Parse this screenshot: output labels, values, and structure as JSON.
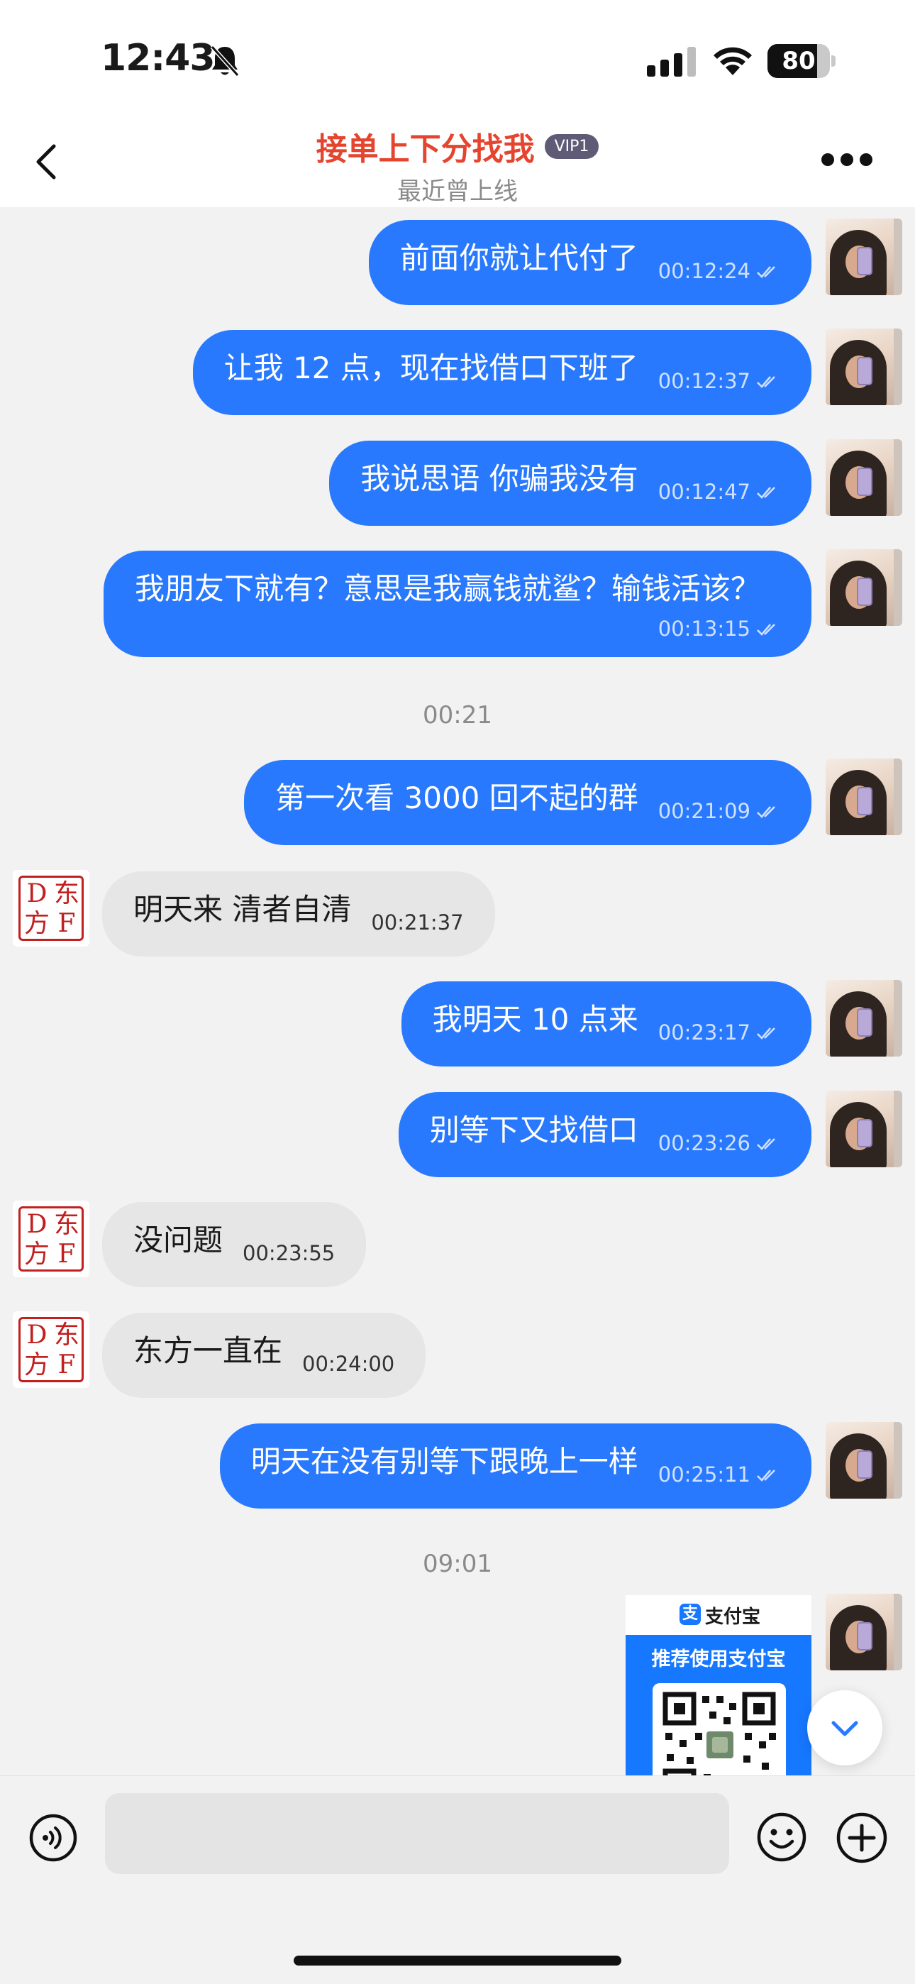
{
  "status_bar": {
    "time": "12:43",
    "battery": 80,
    "icons": [
      "bell-slash-icon",
      "signal-icon",
      "wifi-icon",
      "battery-icon"
    ]
  },
  "header": {
    "title": "接单上下分找我",
    "badge": "VIP1",
    "subtitle": "最近曾上线",
    "back_icon": "chevron-left-icon",
    "more_icon": "more-dots-icon"
  },
  "messages": [
    {
      "dir": "out",
      "text": "前面你就让代付了",
      "time": "00:12:24"
    },
    {
      "dir": "out",
      "text": "让我 12 点，现在找借口下班了",
      "time": "00:12:37"
    },
    {
      "dir": "out",
      "text": "我说思语 你骗我没有",
      "time": "00:12:47"
    },
    {
      "dir": "out",
      "text": "我朋友下就有？意思是我赢钱就鲨？输钱活该？",
      "time": "00:13:15"
    },
    {
      "dir": "divider",
      "text": "00:21"
    },
    {
      "dir": "out",
      "text": "第一次看 3000 回不起的群",
      "time": "00:21:09"
    },
    {
      "dir": "in",
      "text": "明天来  清者自清",
      "time": "00:21:37"
    },
    {
      "dir": "out",
      "text": "我明天 10 点来",
      "time": "00:23:17"
    },
    {
      "dir": "out",
      "text": "别等下又找借口",
      "time": "00:23:26"
    },
    {
      "dir": "in",
      "text": "没问题",
      "time": "00:23:55"
    },
    {
      "dir": "in",
      "text": "东方一直在",
      "time": "00:24:00"
    },
    {
      "dir": "out",
      "text": "明天在没有别等下跟晚上一样",
      "time": "00:25:11"
    },
    {
      "dir": "divider",
      "text": "09:01"
    }
  ],
  "seal_avatar": {
    "chars": [
      "D",
      "东",
      "方",
      "F"
    ]
  },
  "alipay_card": {
    "brand": "支付宝",
    "logo_char": "支",
    "recommend": "推荐使用支付宝"
  },
  "colors": {
    "accent": "#2979ff",
    "title_red": "#e5442f",
    "seal_red": "#c21f1f",
    "alipay_blue": "#1677ff"
  },
  "input_bar": {
    "placeholder": "",
    "icons": [
      "voice-icon",
      "emoji-icon",
      "plus-icon"
    ]
  }
}
